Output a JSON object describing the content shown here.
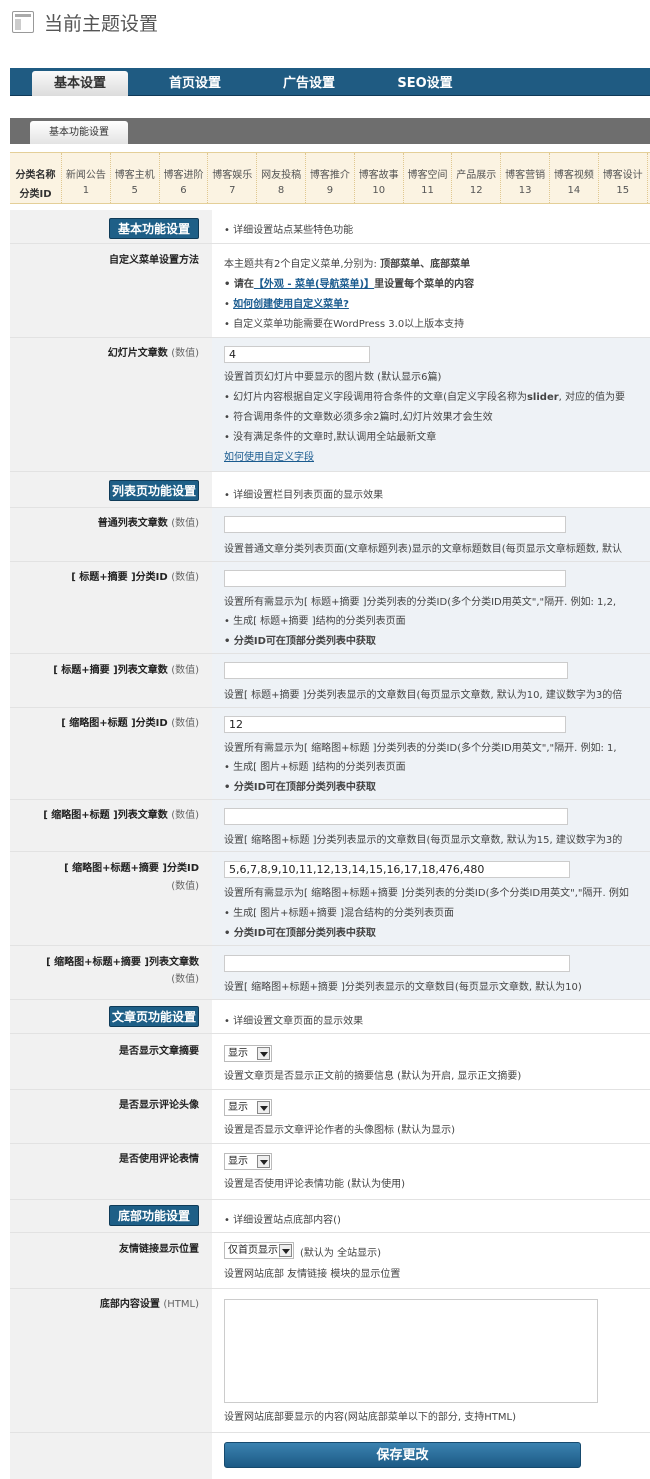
{
  "page_title": "当前主题设置",
  "main_tabs": [
    "基本设置",
    "首页设置",
    "广告设置",
    "SEO设置"
  ],
  "sub_tab": "基本功能设置",
  "category_table": {
    "name_header": "分类名称",
    "id_header": "分类ID",
    "columns": [
      {
        "name": "新闻公告",
        "id": "1"
      },
      {
        "name": "博客主机",
        "id": "5"
      },
      {
        "name": "博客进阶",
        "id": "6"
      },
      {
        "name": "博客娱乐",
        "id": "7"
      },
      {
        "name": "网友投稿",
        "id": "8"
      },
      {
        "name": "博客推介",
        "id": "9"
      },
      {
        "name": "博客故事",
        "id": "10"
      },
      {
        "name": "博客空间",
        "id": "11"
      },
      {
        "name": "产品展示",
        "id": "12"
      },
      {
        "name": "博客营销",
        "id": "13"
      },
      {
        "name": "博客视频",
        "id": "14"
      },
      {
        "name": "博客设计",
        "id": "15"
      }
    ]
  },
  "value_tag": "(数值)",
  "basic": {
    "section_button": "基本功能设置",
    "section_desc": "• 详细设置站点某些特色功能",
    "menu_label": "自定义菜单设置方法",
    "menu_line1_a": "本主题共有2个自定义菜单,分别为: ",
    "menu_line1_b": "顶部菜单、底部菜单",
    "menu_line2_a": "• 请在",
    "menu_line2_link": "【外观 - 菜单(导航菜单)】",
    "menu_line2_b": "里设置每个菜单的内容",
    "menu_line3_a": "• ",
    "menu_line3_link": "如何创建使用自定义菜单?",
    "menu_line4": "• 自定义菜单功能需要在WordPress 3.0以上版本支持",
    "slider_label": "幻灯片文章数",
    "slider_value": "4",
    "slider_line1": "设置首页幻灯片中要显示的图片数 (默认显示6篇)",
    "slider_line2_a": "• 幻灯片内容根据自定义字段调用符合条件的文章(自定义字段名称为",
    "slider_line2_b": "slider",
    "slider_line2_c": ", 对应的值为要",
    "slider_line3": "• 符合调用条件的文章数必须多余2篇时,幻灯片效果才会生效",
    "slider_line4": "• 没有满足条件的文章时,默认调用全站最新文章",
    "slider_line5_link": "如何使用自定义字段"
  },
  "list": {
    "section_button": "列表页功能设置",
    "section_desc": "• 详细设置栏目列表页面的显示效果",
    "normal_label": "普通列表文章数",
    "normal_value": "",
    "normal_desc": "设置普通文章分类列表页面(文章标题列表)显示的文章标题数目(每页显示文章标题数, 默认",
    "ts_id_label": "[ 标题+摘要 ]分类ID",
    "ts_id_value": "",
    "ts_id_desc": "设置所有需显示为[ 标题+摘要 ]分类列表的分类ID(多个分类ID用英文\",\"隔开. 例如: 1,2,",
    "ts_id_line2": "• 生成[ 标题+摘要 ]结构的分类列表页面",
    "ts_id_line3": "• 分类ID可在顶部分类列表中获取",
    "ts_num_label": "[ 标题+摘要 ]列表文章数",
    "ts_num_value": "",
    "ts_num_desc": "设置[ 标题+摘要 ]分类列表显示的文章数目(每页显示文章数, 默认为10, 建议数字为3的倍",
    "tt_id_label": "[ 缩略图+标题 ]分类ID",
    "tt_id_value": "12",
    "tt_id_desc": "设置所有需显示为[ 缩略图+标题 ]分类列表的分类ID(多个分类ID用英文\",\"隔开. 例如: 1,",
    "tt_id_line2": "• 生成[ 图片+标题 ]结构的分类列表页面",
    "tt_id_line3": "• 分类ID可在顶部分类列表中获取",
    "tt_num_label": "[ 缩略图+标题 ]列表文章数",
    "tt_num_value": "",
    "tt_num_desc": "设置[ 缩略图+标题 ]分类列表显示的文章数目(每页显示文章数, 默认为15, 建议数字为3的",
    "tts_id_label": "[ 缩略图+标题+摘要 ]分类ID",
    "tts_id_value": "5,6,7,8,9,10,11,12,13,14,15,16,17,18,476,480",
    "tts_id_desc": "设置所有需显示为[ 缩略图+标题+摘要 ]分类列表的分类ID(多个分类ID用英文\",\"隔开. 例如",
    "tts_id_line2": "• 生成[ 图片+标题+摘要 ]混合结构的分类列表页面",
    "tts_id_line3": "• 分类ID可在顶部分类列表中获取",
    "tts_num_label": "[ 缩略图+标题+摘要 ]列表文章数",
    "tts_num_value": "",
    "tts_num_desc": "设置[ 缩略图+标题+摘要 ]分类列表显示的文章数目(每页显示文章数, 默认为10)"
  },
  "article": {
    "section_button": "文章页功能设置",
    "section_desc": "• 详细设置文章页面的显示效果",
    "summary_label": "是否显示文章摘要",
    "summary_value": "显示",
    "summary_desc": "设置文章页是否显示正文前的摘要信息 (默认为开启, 显示正文摘要)",
    "avatar_label": "是否显示评论头像",
    "avatar_value": "显示",
    "avatar_desc": "设置是否显示文章评论作者的头像图标 (默认为显示)",
    "emoji_label": "是否使用评论表情",
    "emoji_value": "显示",
    "emoji_desc": "设置是否使用评论表情功能 (默认为使用)"
  },
  "footer": {
    "section_button": "底部功能设置",
    "section_desc": "• 详细设置站点底部内容()",
    "links_label": "友情链接显示位置",
    "links_value": "仅首页显示",
    "links_default": "(默认为 全站显示)",
    "links_desc": "设置网站底部 友情链接 模块的显示位置",
    "content_label": "底部内容设置",
    "content_tag": "(HTML)",
    "content_value": "",
    "content_desc": "设置网站底部要显示的内容(网站底部菜单以下的部分, 支持HTML)"
  },
  "save_button": "保存更改"
}
